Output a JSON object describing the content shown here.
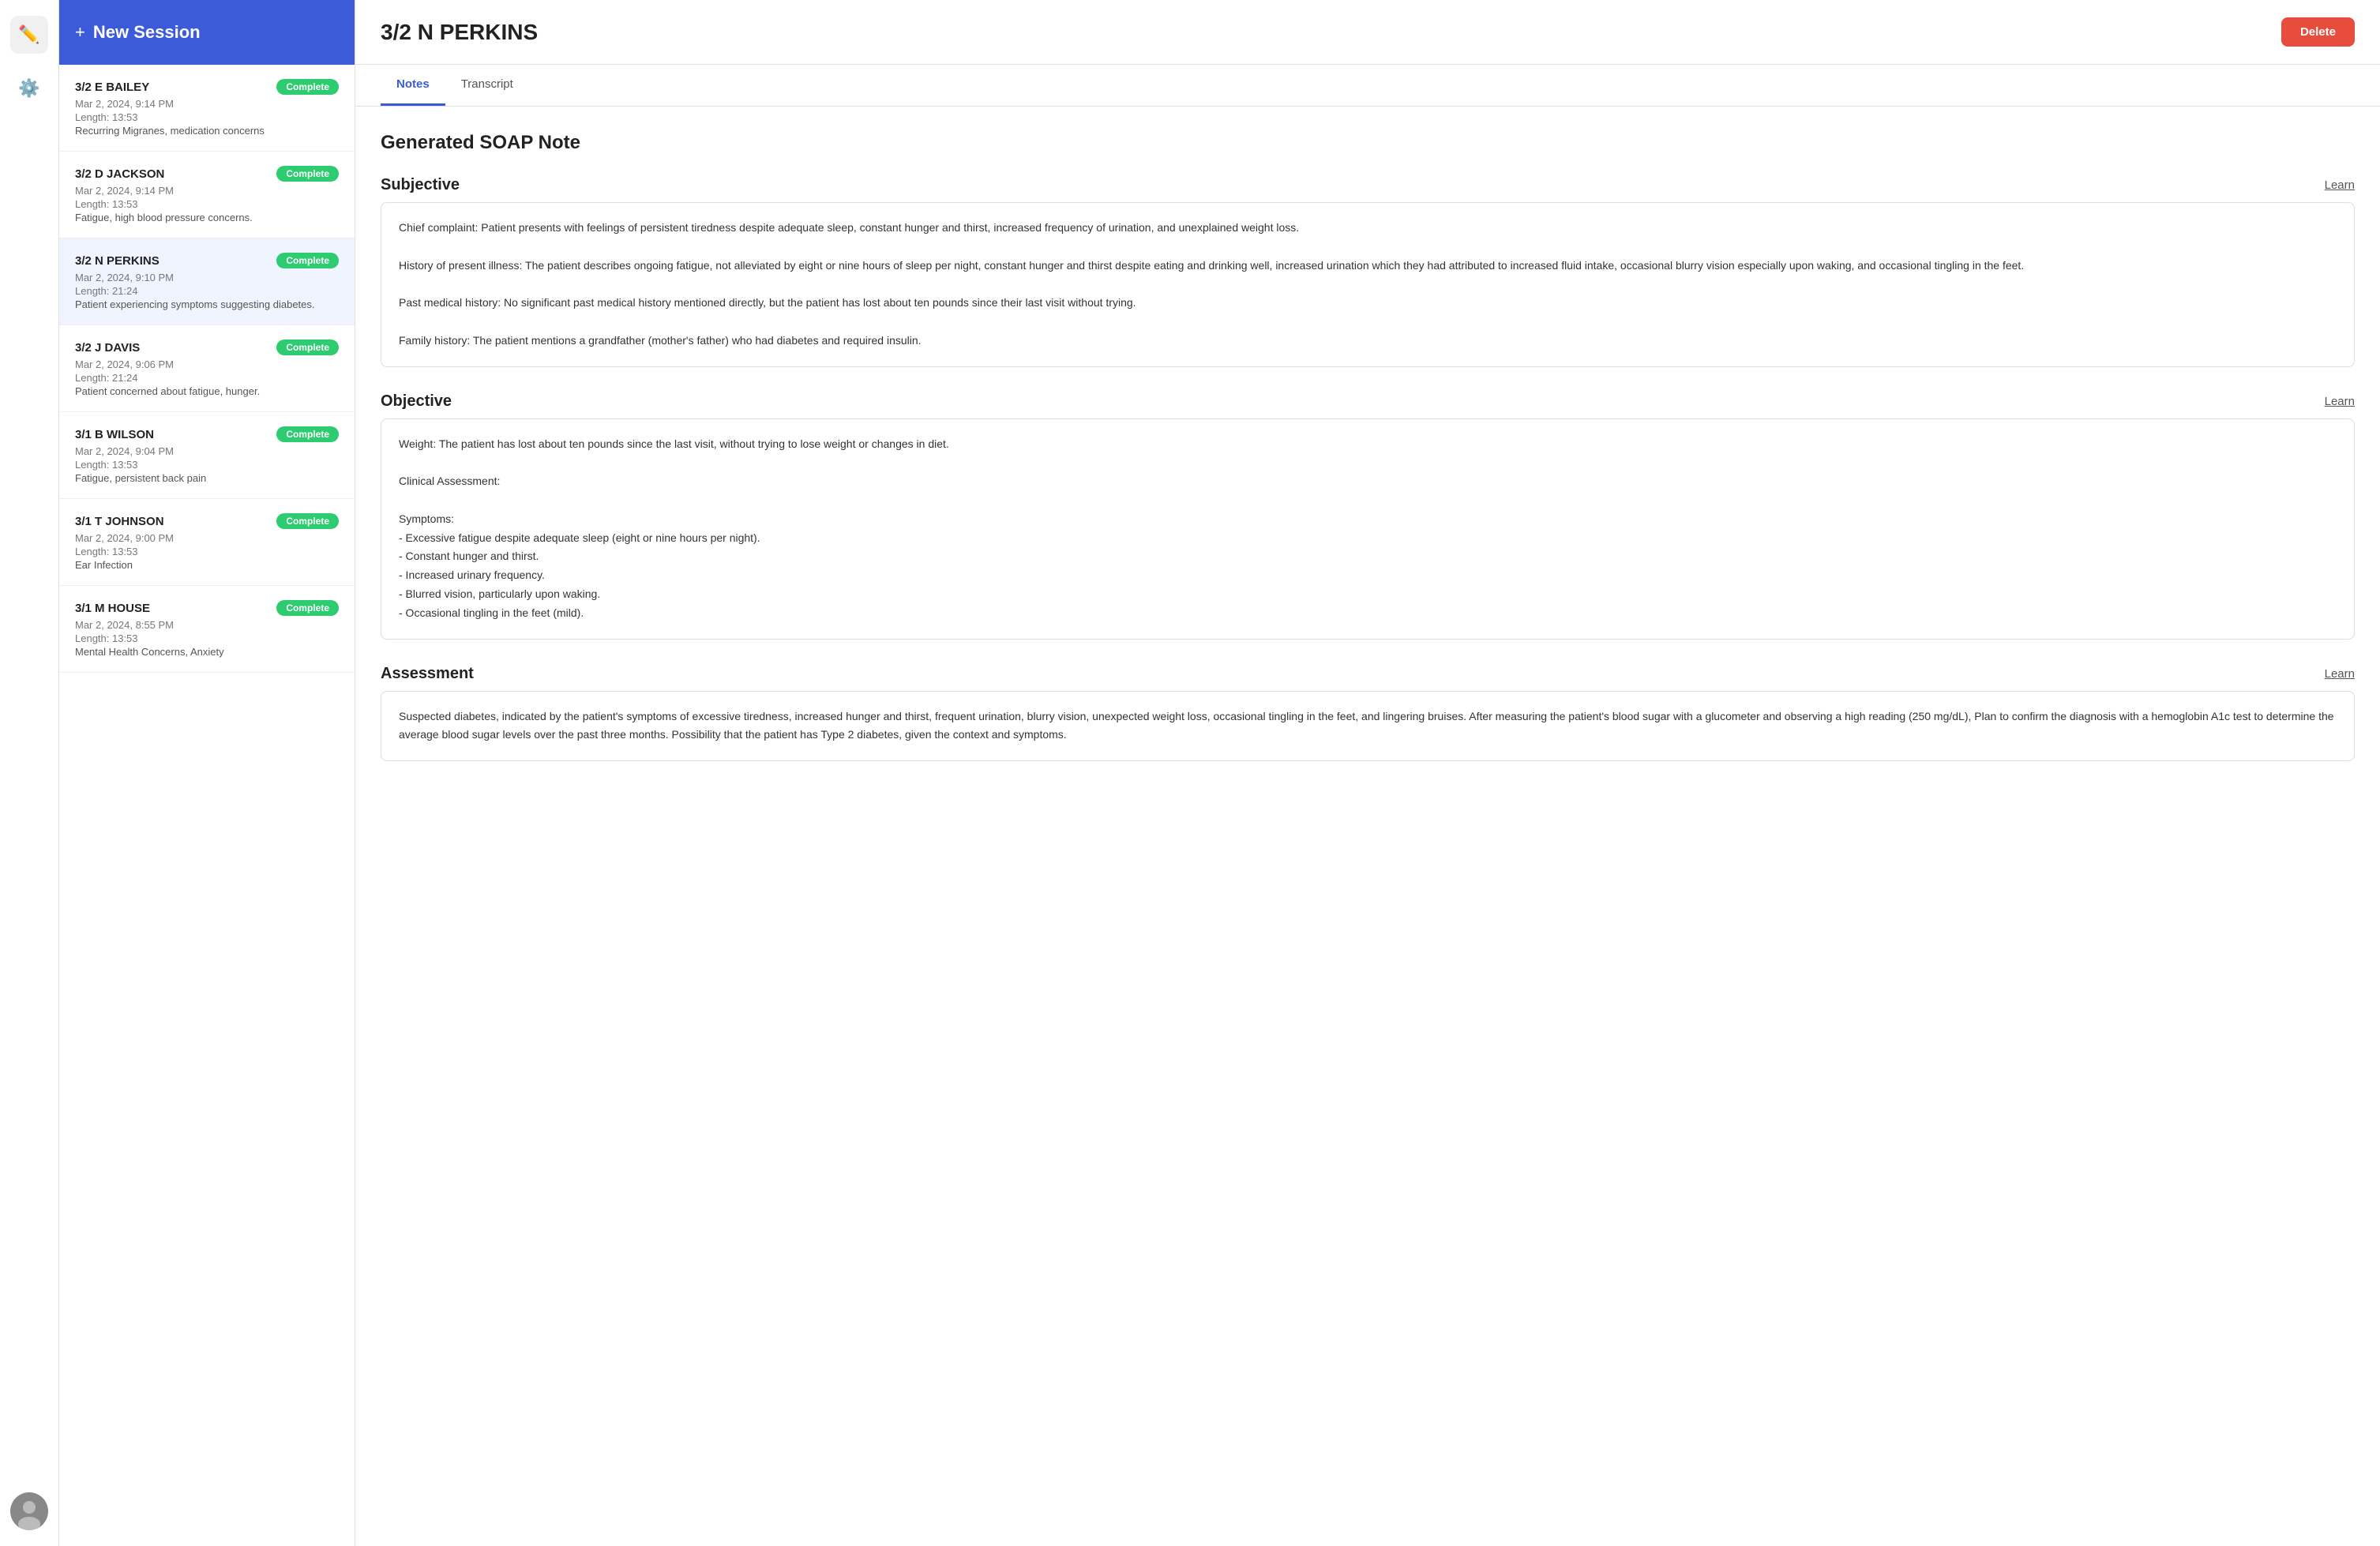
{
  "app": {
    "new_session_label": "New Session",
    "delete_label": "Delete"
  },
  "tabs": [
    {
      "id": "notes",
      "label": "Notes",
      "active": true
    },
    {
      "id": "transcript",
      "label": "Transcript",
      "active": false
    }
  ],
  "main_patient": "3/2 N PERKINS",
  "soap": {
    "title": "Generated SOAP Note",
    "sections": [
      {
        "id": "subjective",
        "title": "Subjective",
        "learn_label": "Learn",
        "content": "Chief complaint: Patient presents with feelings of persistent tiredness despite adequate sleep, constant hunger and thirst, increased frequency of urination, and unexplained weight loss.\n\nHistory of present illness: The patient describes ongoing fatigue, not alleviated by eight or nine hours of sleep per night, constant hunger and thirst despite eating and drinking well, increased urination which they had attributed to increased fluid intake, occasional blurry vision especially upon waking, and occasional tingling in the feet.\n\nPast medical history: No significant past medical history mentioned directly, but the patient has lost about ten pounds since their last visit without trying.\n\nFamily history: The patient mentions a grandfather (mother's father) who had diabetes and required insulin."
      },
      {
        "id": "objective",
        "title": "Objective",
        "learn_label": "Learn",
        "content": "Weight: The patient has lost about ten pounds since the last visit, without trying to lose weight or changes in diet.\n\nClinical Assessment:\n\nSymptoms:\n- Excessive fatigue despite adequate sleep (eight or nine hours per night).\n- Constant hunger and thirst.\n- Increased urinary frequency.\n- Blurred vision, particularly upon waking.\n- Occasional tingling in the feet (mild)."
      },
      {
        "id": "assessment",
        "title": "Assessment",
        "learn_label": "Learn",
        "content": "Suspected diabetes, indicated by the patient's symptoms of excessive tiredness, increased hunger and thirst, frequent urination, blurry vision, unexpected weight loss, occasional tingling in the feet, and lingering bruises. After measuring the patient's blood sugar with a glucometer and observing a high reading (250 mg/dL), Plan to confirm the diagnosis with a hemoglobin A1c test to determine the average blood sugar levels over the past three months. Possibility that the patient has Type 2 diabetes, given the context and symptoms."
      }
    ]
  },
  "sessions": [
    {
      "id": "bailey",
      "name": "3/2 E BAILEY",
      "date": "Mar 2, 2024, 9:14 PM",
      "length": "Length: 13:53",
      "description": "Recurring Migranes, medication concerns",
      "status": "Complete",
      "active": false
    },
    {
      "id": "jackson",
      "name": "3/2 D JACKSON",
      "date": "Mar 2, 2024, 9:14 PM",
      "length": "Length: 13:53",
      "description": "Fatigue, high blood pressure concerns.",
      "status": "Complete",
      "active": false
    },
    {
      "id": "perkins",
      "name": "3/2 N PERKINS",
      "date": "Mar 2, 2024, 9:10 PM",
      "length": "Length: 21:24",
      "description": "Patient experiencing symptoms suggesting diabetes.",
      "status": "Complete",
      "active": true
    },
    {
      "id": "davis",
      "name": "3/2 J DAVIS",
      "date": "Mar 2, 2024, 9:06 PM",
      "length": "Length: 21:24",
      "description": "Patient concerned about fatigue, hunger.",
      "status": "Complete",
      "active": false
    },
    {
      "id": "wilson",
      "name": "3/1 B WILSON",
      "date": "Mar 2, 2024, 9:04 PM",
      "length": "Length: 13:53",
      "description": "Fatigue, persistent back pain",
      "status": "Complete",
      "active": false
    },
    {
      "id": "johnson",
      "name": "3/1 T JOHNSON",
      "date": "Mar 2, 2024, 9:00 PM",
      "length": "Length: 13:53",
      "description": "Ear Infection",
      "status": "Complete",
      "active": false
    },
    {
      "id": "house",
      "name": "3/1 M HOUSE",
      "date": "Mar 2, 2024, 8:55 PM",
      "length": "Length: 13:53",
      "description": "Mental Health Concerns, Anxiety",
      "status": "Complete",
      "active": false
    }
  ],
  "icons": {
    "new_session": "+",
    "edit": "✏",
    "gear": "⚙",
    "avatar": "👤"
  }
}
